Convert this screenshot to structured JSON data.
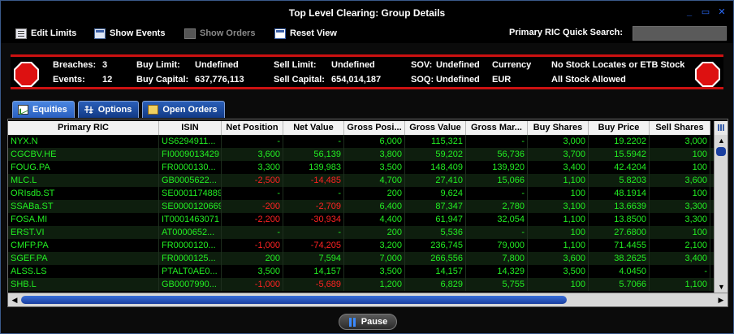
{
  "window": {
    "title": "Top Level Clearing: Group Details",
    "minimize_label": "_",
    "maximize_label": "▭",
    "close_label": "✕"
  },
  "toolbar": {
    "edit_limits": "Edit Limits",
    "show_events": "Show Events",
    "show_orders": "Show Orders",
    "reset_view": "Reset View",
    "search_label": "Primary RIC Quick Search:",
    "search_value": ""
  },
  "summary": {
    "breaches_label": "Breaches:",
    "breaches_value": "3",
    "events_label": "Events:",
    "events_value": "12",
    "buy_limit_label": "Buy Limit:",
    "buy_limit_value": "Undefined",
    "buy_capital_label": "Buy Capital:",
    "buy_capital_value": "637,776,113",
    "sell_limit_label": "Sell Limit:",
    "sell_limit_value": "Undefined",
    "sell_capital_label": "Sell Capital:",
    "sell_capital_value": "654,014,187",
    "sov_label": "SOV:",
    "sov_value": "Undefined",
    "soq_label": "SOQ:",
    "soq_value": "Undefined",
    "currency_label": "Currency",
    "currency_value": "EUR",
    "stock_locate": "No Stock Locates or ETB Stock",
    "stock_allowed": "All Stock Allowed"
  },
  "tabs": [
    {
      "label": "Equities",
      "active": true
    },
    {
      "label": "Options",
      "active": false
    },
    {
      "label": "Open Orders",
      "active": false
    }
  ],
  "grid": {
    "columns": [
      "Primary RIC",
      "ISIN",
      "Net Position",
      "Net Value",
      "Gross Posi...",
      "Gross Value",
      "Gross Mar...",
      "Buy Shares",
      "Buy Price",
      "Sell Shares"
    ],
    "rows": [
      [
        "NYX.N",
        "US6294911...",
        "-",
        "-",
        "6,000",
        "115,321",
        "-",
        "3,000",
        "19.2202",
        "3,000"
      ],
      [
        "CGCBV.HE",
        "FI0009013429",
        "3,600",
        "56,139",
        "3,800",
        "59,202",
        "56,736",
        "3,700",
        "15.5942",
        "100"
      ],
      [
        "FOUG.PA",
        "FR0000130...",
        "3,300",
        "139,983",
        "3,500",
        "148,409",
        "139,920",
        "3,400",
        "42.4204",
        "100"
      ],
      [
        "MLC.L",
        "GB0005622...",
        "-2,500",
        "-14,485",
        "4,700",
        "27,410",
        "15,066",
        "1,100",
        "5.8203",
        "3,600"
      ],
      [
        "ORIsdb.ST",
        "SE0001174889",
        "-",
        "-",
        "200",
        "9,624",
        "-",
        "100",
        "48.1914",
        "100"
      ],
      [
        "SSABa.ST",
        "SE0000120669",
        "-200",
        "-2,709",
        "6,400",
        "87,347",
        "2,780",
        "3,100",
        "13.6639",
        "3,300"
      ],
      [
        "FOSA.MI",
        "IT0001463071",
        "-2,200",
        "-30,934",
        "4,400",
        "61,947",
        "32,054",
        "1,100",
        "13.8500",
        "3,300"
      ],
      [
        "ERST.VI",
        "AT0000652...",
        "-",
        "-",
        "200",
        "5,536",
        "-",
        "100",
        "27.6800",
        "100"
      ],
      [
        "CMFP.PA",
        "FR0000120...",
        "-1,000",
        "-74,205",
        "3,200",
        "236,745",
        "79,000",
        "1,100",
        "71.4455",
        "2,100"
      ],
      [
        "SGEF.PA",
        "FR0000125...",
        "200",
        "7,594",
        "7,000",
        "266,556",
        "7,800",
        "3,600",
        "38.2625",
        "3,400"
      ],
      [
        "ALSS.LS",
        "PTALT0AE0...",
        "3,500",
        "14,157",
        "3,500",
        "14,157",
        "14,329",
        "3,500",
        "4.0450",
        "-"
      ],
      [
        "SHB.L",
        "GB0007990...",
        "-1,000",
        "-5,689",
        "1,200",
        "6,829",
        "5,755",
        "100",
        "5.7066",
        "1,100"
      ]
    ]
  },
  "pause_label": "Pause"
}
